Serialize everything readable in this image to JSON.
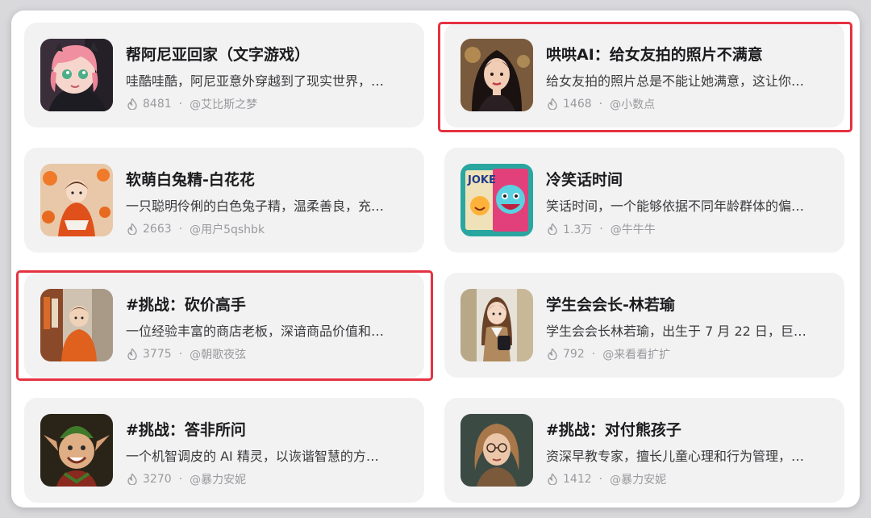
{
  "cards": [
    {
      "title": "帮阿尼亚回家（文字游戏）",
      "desc": "哇酷哇酷，阿尼亚意外穿越到了现实世界，…",
      "count": "8481",
      "author": "@艾比斯之梦"
    },
    {
      "title": "哄哄AI：给女友拍的照片不满意",
      "desc": "给女友拍的照片总是不能让她满意，这让你…",
      "count": "1468",
      "author": "@小数点"
    },
    {
      "title": "软萌白兔精-白花花",
      "desc": "一只聪明伶俐的白色兔子精，温柔善良，充…",
      "count": "2663",
      "author": "@用户5qshbk"
    },
    {
      "title": "冷笑话时间",
      "desc": "笑话时间，一个能够依据不同年龄群体的偏…",
      "count": "1.3万",
      "author": "@牛牛牛"
    },
    {
      "title": "#挑战：砍价高手",
      "desc": "一位经验丰富的商店老板，深谙商品价值和…",
      "count": "3775",
      "author": "@朝歌夜弦"
    },
    {
      "title": "学生会会长-林若瑜",
      "desc": "学生会会长林若瑜，出生于 7 月 22 日，巨…",
      "count": "792",
      "author": "@来看看扩扩"
    },
    {
      "title": "#挑战：答非所问",
      "desc": "一个机智调皮的 AI 精灵，以诙谐智慧的方…",
      "count": "3270",
      "author": "@暴力安妮"
    },
    {
      "title": "#挑战：对付熊孩子",
      "desc": "资深早教专家，擅长儿童心理和行为管理，…",
      "count": "1412",
      "author": "@暴力安妮"
    }
  ],
  "avatar_images": {
    "joke_poster_text": "JOKE"
  },
  "colors": {
    "highlight": "#e53241",
    "card_bg": "#f2f2f3",
    "title": "#1b1b1d",
    "meta": "#9a9a9e"
  },
  "icons": {
    "popularity": "fire-icon"
  }
}
